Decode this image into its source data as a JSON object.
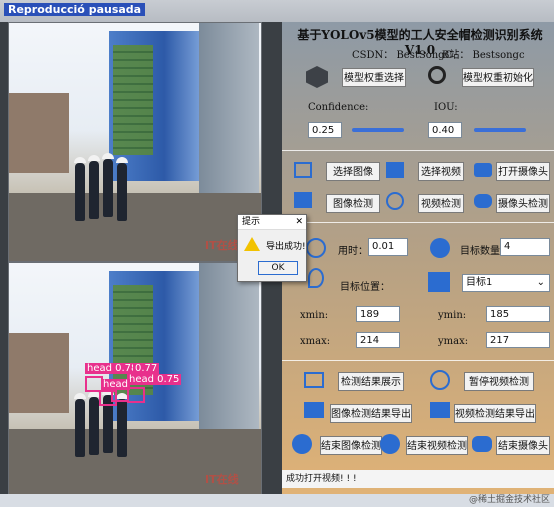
{
  "window": {
    "title": "Reproducció pausada"
  },
  "app": {
    "title": "基于YOLOv5模型的工人安全帽检测识别系统V1.0",
    "csdn": "CSDN： BestSongC",
    "bilibili": "B站： Bestsongc"
  },
  "model": {
    "select_label": "模型权重选择",
    "init_label": "模型权重初始化"
  },
  "params": {
    "confidence_label": "Confidence:",
    "confidence_value": "0.25",
    "iou_label": "IOU:",
    "iou_value": "0.40"
  },
  "buttons": {
    "select_image": "选择图像",
    "select_video": "选择视频",
    "open_camera": "打开摄像头",
    "image_detect": "图像检测",
    "video_detect": "视频检测",
    "camera_detect": "摄像头检测",
    "show_result": "检测结果展示",
    "pause_video": "暂停视频检测",
    "export_image": "图像检测结果导出",
    "export_video": "视频检测结果导出",
    "end_image": "结束图像检测",
    "end_video": "结束视频检测",
    "end_camera": "结束摄像头"
  },
  "stats": {
    "time_label": "用时：",
    "time_value": "0.01",
    "count_label": "目标数量：",
    "count_value": "4",
    "position_label": "目标位置：",
    "target_select": "目标1",
    "xmin_label": "xmin:",
    "xmin_value": "189",
    "ymin_label": "ymin:",
    "ymin_value": "185",
    "xmax_label": "xmax:",
    "xmax_value": "214",
    "ymax_label": "ymax:",
    "ymax_value": "217"
  },
  "detections": [
    {
      "label": "head 0.78"
    },
    {
      "label": "0.77"
    },
    {
      "label": "head 0.75"
    },
    {
      "label": "head"
    }
  ],
  "watermark": "IT在线",
  "dialog": {
    "title": "提示",
    "message": "导出成功!",
    "ok": "OK"
  },
  "status": "成功打开视频! ! !",
  "footer_watermark": "@稀土掘金技术社区"
}
